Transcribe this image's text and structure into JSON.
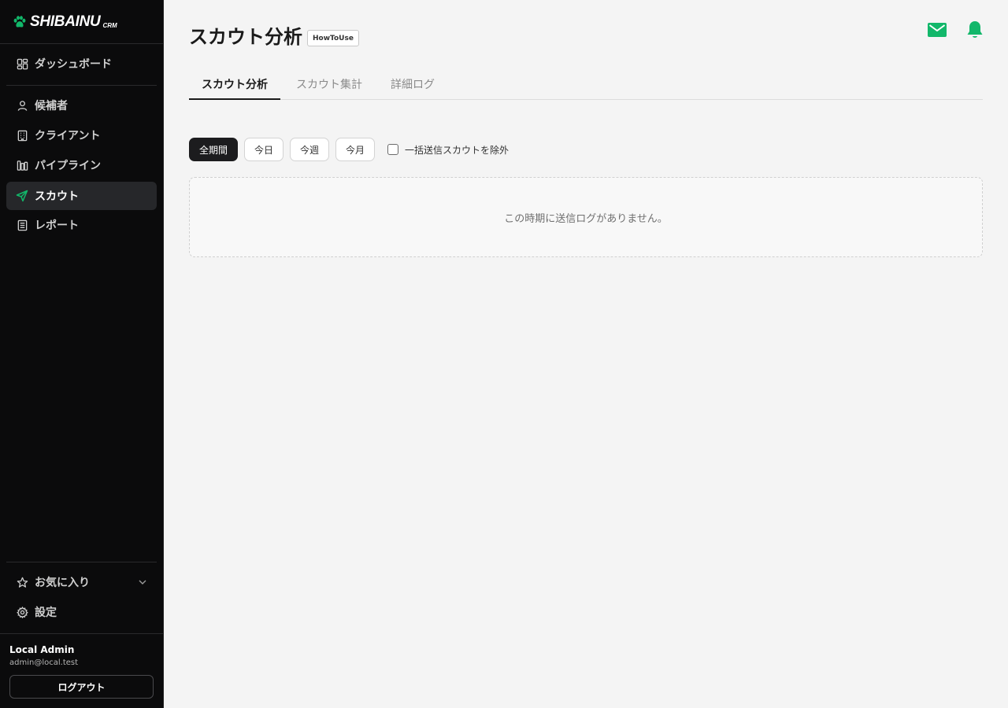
{
  "brand": {
    "name": "SHIBAINU",
    "suffix": "CRM",
    "accent": "#12b76a"
  },
  "sidebar": {
    "top_items": [
      {
        "label": "ダッシュボード",
        "icon": "dashboard-icon"
      }
    ],
    "items": [
      {
        "label": "候補者",
        "icon": "user-icon"
      },
      {
        "label": "クライアント",
        "icon": "building-icon"
      },
      {
        "label": "パイプライン",
        "icon": "pipeline-icon"
      },
      {
        "label": "スカウト",
        "icon": "send-icon",
        "active": true
      },
      {
        "label": "レポート",
        "icon": "report-icon"
      }
    ],
    "bottom_items": [
      {
        "label": "お気に入り",
        "icon": "star-icon"
      },
      {
        "label": "設定",
        "icon": "gear-icon"
      }
    ]
  },
  "user": {
    "name": "Local Admin",
    "email": "admin@local.test",
    "logout_label": "ログアウト"
  },
  "header": {
    "title": "スカウト分析",
    "howto_label": "HowToUse"
  },
  "tabs": [
    {
      "label": "スカウト分析",
      "active": true
    },
    {
      "label": "スカウト集計"
    },
    {
      "label": "詳細ログ"
    }
  ],
  "filters": {
    "periods": [
      {
        "label": "全期間",
        "active": true
      },
      {
        "label": "今日"
      },
      {
        "label": "今週"
      },
      {
        "label": "今月"
      }
    ],
    "exclude_bulk_label": "一括送信スカウトを除外",
    "exclude_bulk_checked": false
  },
  "empty_state": {
    "message": "この時期に送信ログがありません。"
  }
}
